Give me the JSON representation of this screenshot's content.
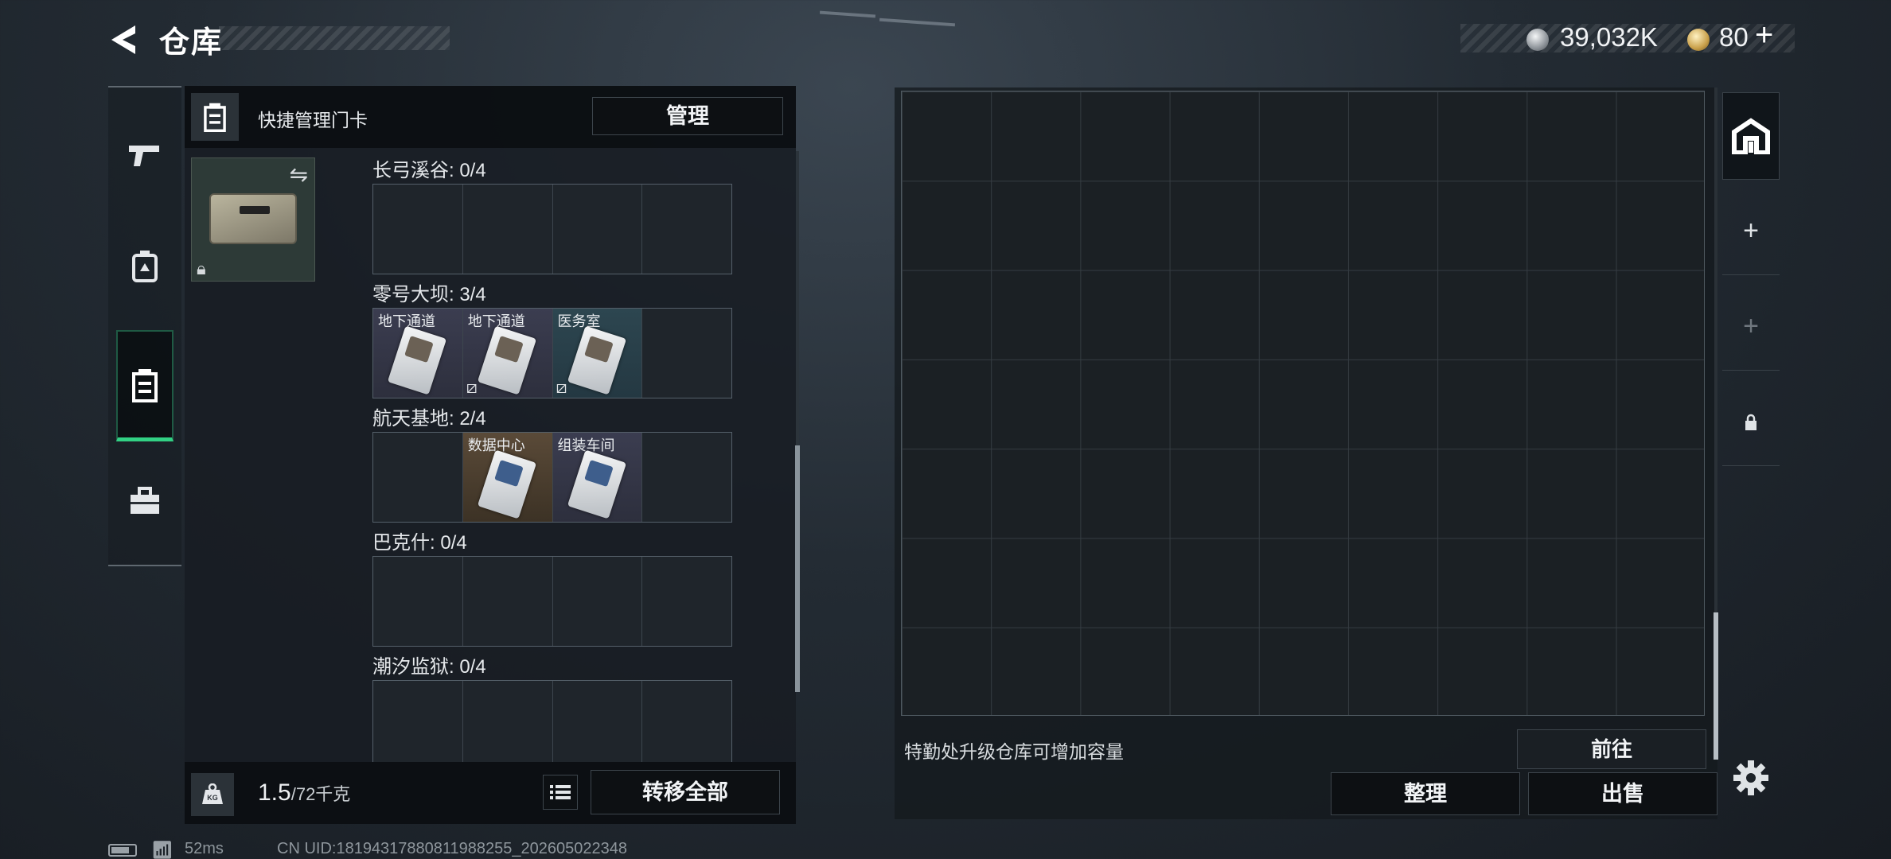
{
  "header": {
    "title": "仓库",
    "currency": {
      "silver_amount": "39,032K",
      "gold_amount": "80"
    }
  },
  "left_nav": {
    "items": [
      {
        "icon": "pistol-icon",
        "active": false
      },
      {
        "icon": "backpack-icon",
        "active": false
      },
      {
        "icon": "keycard-case-icon",
        "active": true
      },
      {
        "icon": "toolbox-icon",
        "active": false
      }
    ]
  },
  "keycard_panel": {
    "header_title": "快捷管理门卡",
    "manage_label": "管理",
    "maps": [
      {
        "label": "长弓溪谷: 0/4",
        "slots": [
          {
            "label": ""
          },
          {
            "label": ""
          },
          {
            "label": ""
          },
          {
            "label": ""
          }
        ]
      },
      {
        "label": "零号大坝: 3/4",
        "slots": [
          {
            "label": "地下通道",
            "tint": "purple",
            "art": "brown",
            "mark": ""
          },
          {
            "label": "地下通道",
            "tint": "purple",
            "art": "brown",
            "mark": "⧄"
          },
          {
            "label": "医务室",
            "tint": "teal",
            "art": "brown",
            "mark": "⧄"
          },
          {
            "label": ""
          }
        ]
      },
      {
        "label": "航天基地: 2/4",
        "slots": [
          {
            "label": ""
          },
          {
            "label": "数据中心",
            "tint": "amber",
            "art": "blue",
            "mark": ""
          },
          {
            "label": "组装车间",
            "tint": "purple",
            "art": "blue",
            "mark": ""
          },
          {
            "label": ""
          }
        ]
      },
      {
        "label": "巴克什: 0/4",
        "slots": [
          {
            "label": ""
          },
          {
            "label": ""
          },
          {
            "label": ""
          },
          {
            "label": ""
          }
        ]
      },
      {
        "label": "潮汐监狱: 0/4",
        "slots": [
          {
            "label": ""
          },
          {
            "label": ""
          },
          {
            "label": ""
          },
          {
            "label": ""
          }
        ]
      }
    ],
    "footer": {
      "weight_value": "1.5",
      "weight_capacity": "/72千克",
      "transfer_all_label": "转移全部"
    }
  },
  "stash": {
    "upgrade_hint": "特勤处升级仓库可增加容量",
    "goto_label": "前往",
    "sort_label": "整理",
    "sell_label": "出售"
  },
  "right_strip": {
    "items": [
      "home-stash-icon",
      "plus-icon",
      "plus-icon-disabled",
      "lock-icon"
    ]
  },
  "status": {
    "ping": "52ms",
    "uid": "CN UID:18194317880811988255_202605022348"
  }
}
